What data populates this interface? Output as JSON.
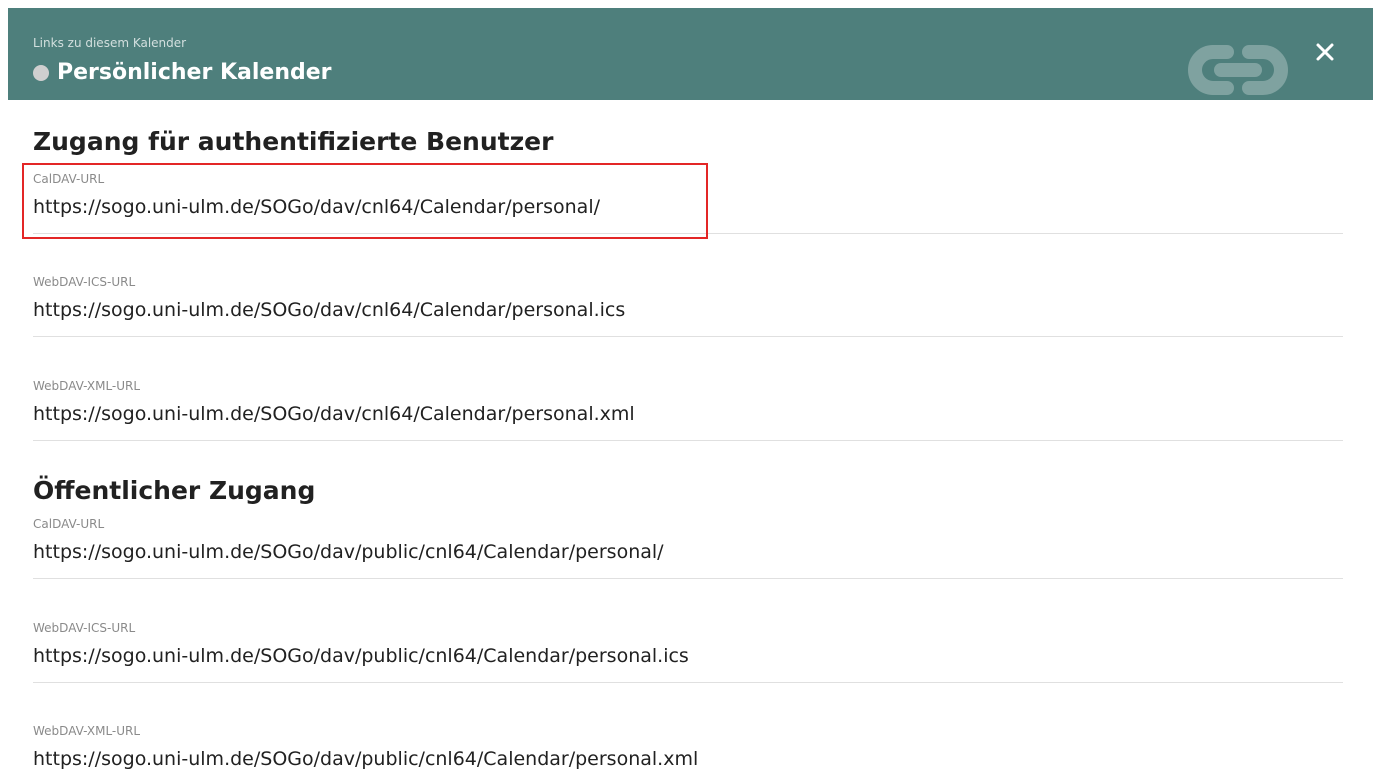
{
  "header": {
    "subtitle": "Links zu diesem Kalender",
    "title": "Persönlicher Kalender",
    "calendar_color": "#cfcfcf",
    "accent": "#4e7f7c",
    "icons": {
      "link": "link-icon",
      "close": "close-icon"
    }
  },
  "sections": [
    {
      "title": "Zugang für authentifizierte Benutzer",
      "fields": [
        {
          "label": "CalDAV-URL",
          "value": "https://sogo.uni-ulm.de/SOGo/dav/cnl64/Calendar/personal/"
        },
        {
          "label": "WebDAV-ICS-URL",
          "value": "https://sogo.uni-ulm.de/SOGo/dav/cnl64/Calendar/personal.ics"
        },
        {
          "label": "WebDAV-XML-URL",
          "value": "https://sogo.uni-ulm.de/SOGo/dav/cnl64/Calendar/personal.xml"
        }
      ]
    },
    {
      "title": "Öffentlicher Zugang",
      "fields": [
        {
          "label": "CalDAV-URL",
          "value": "https://sogo.uni-ulm.de/SOGo/dav/public/cnl64/Calendar/personal/"
        },
        {
          "label": "WebDAV-ICS-URL",
          "value": "https://sogo.uni-ulm.de/SOGo/dav/public/cnl64/Calendar/personal.ics"
        },
        {
          "label": "WebDAV-XML-URL",
          "value": "https://sogo.uni-ulm.de/SOGo/dav/public/cnl64/Calendar/personal.xml"
        }
      ]
    }
  ],
  "highlight_color": "#e32626"
}
